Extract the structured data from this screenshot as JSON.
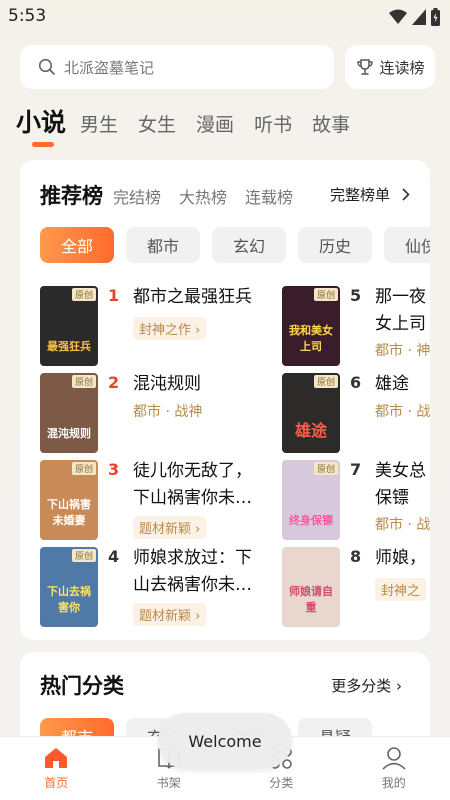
{
  "status": {
    "time": "5:53"
  },
  "search": {
    "placeholder": "北派盗墓笔记"
  },
  "rank_button": {
    "label": "连读榜"
  },
  "tabs": [
    {
      "label": "小说",
      "active": true
    },
    {
      "label": "男生"
    },
    {
      "label": "女生"
    },
    {
      "label": "漫画"
    },
    {
      "label": "听书"
    },
    {
      "label": "故事"
    }
  ],
  "recommend": {
    "title": "推荐榜",
    "subtabs": [
      "完结榜",
      "大热榜",
      "连载榜"
    ],
    "full_link": "完整榜单",
    "chips": [
      "全部",
      "都市",
      "玄幻",
      "历史",
      "仙侠"
    ],
    "books": [
      {
        "rank": "1",
        "title": "都市之最强狂兵",
        "tag": "封神之作 ›",
        "badge": "原创",
        "cover_text": "最强狂兵",
        "cover_bg": "#2a2a2a",
        "cover_fg": "#f6c143"
      },
      {
        "rank": "2",
        "title": "混沌规则",
        "tagline": "都市 · 战神",
        "badge": "原创",
        "cover_text": "混沌规则",
        "cover_bg": "#7d5a45",
        "cover_fg": "#fff"
      },
      {
        "rank": "3",
        "title": "徒儿你无敌了，下山祸害你未…",
        "tag": "题材新颖 ›",
        "badge": "原创",
        "cover_text": "下山祸害未婚妻",
        "cover_bg": "#c88a56",
        "cover_fg": "#fff"
      },
      {
        "rank": "4",
        "title": "师娘求放过：下山去祸害你未…",
        "tag": "题材新颖 ›",
        "badge": "原创",
        "cover_text": "下山去祸害你",
        "cover_bg": "#4f79a6",
        "cover_fg": "#ffe36a"
      },
      {
        "rank": "5",
        "title": "那一夜女上司",
        "tagline": "都市 · 神",
        "badge": "原创",
        "cover_text": "我和美女上司",
        "cover_bg": "#3a1d2a",
        "cover_fg": "#ffd84a"
      },
      {
        "rank": "6",
        "title": "雄途",
        "tagline": "都市 · 战",
        "badge": "原创",
        "cover_text": "雄途",
        "cover_bg": "#2d2a2a",
        "cover_fg": "#ff5a4a"
      },
      {
        "rank": "7",
        "title": "美女总保镖",
        "tagline": "都市 · 战",
        "badge": "原创",
        "cover_text": "终身保镖",
        "cover_bg": "#d7c9db",
        "cover_fg": "#ff5aa0"
      },
      {
        "rank": "8",
        "title": "师娘，",
        "tag": "封神之",
        "badge": "原创",
        "cover_text": "师娘请自重",
        "cover_bg": "#e9d7cf",
        "cover_fg": "#d24a6a"
      }
    ]
  },
  "hot": {
    "title": "热门分类",
    "more": "更多分类  ›",
    "chips": [
      "都市",
      "玄幻",
      "游戏",
      "悬疑"
    ]
  },
  "toast": {
    "text": "Welcome"
  },
  "bottom_nav": [
    {
      "label": "首页",
      "active": true
    },
    {
      "label": "书架"
    },
    {
      "label": "分类"
    },
    {
      "label": "我的"
    }
  ]
}
